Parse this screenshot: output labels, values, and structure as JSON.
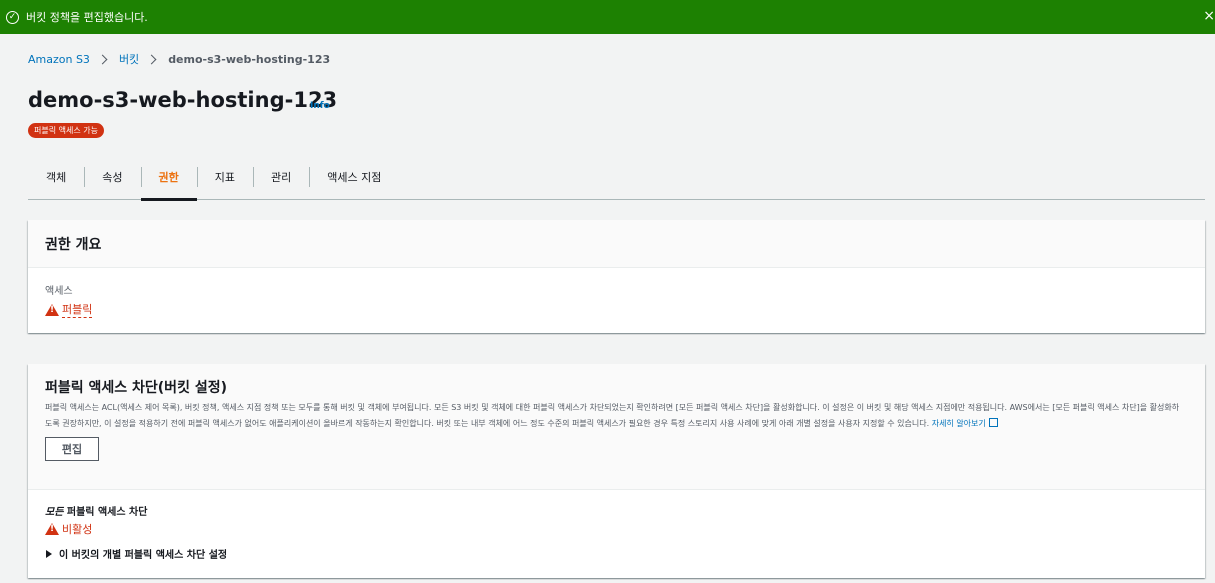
{
  "flash": {
    "message": "버킷 정책을 편집했습니다.",
    "close": "×"
  },
  "breadcrumb": {
    "items": [
      "Amazon S3",
      "버킷"
    ],
    "current": "demo-s3-web-hosting-123"
  },
  "header": {
    "title": "demo-s3-web-hosting-123",
    "info": "Info",
    "badge": "퍼블릭 액세스 가능"
  },
  "tabs": [
    {
      "label": "객체"
    },
    {
      "label": "속성"
    },
    {
      "label": "권한",
      "active": true
    },
    {
      "label": "지표"
    },
    {
      "label": "관리"
    },
    {
      "label": "액세스 지점"
    }
  ],
  "permissions_overview": {
    "title": "권한 개요",
    "access_label": "액세스",
    "access_value": "퍼블릭"
  },
  "block_public_access": {
    "title": "퍼블릭 액세스 차단(버킷 설정)",
    "description": "퍼블릭 액세스는 ACL(액세스 제어 목록), 버킷 정책, 액세스 지점 정책 또는 모두를 통해 버킷 및 객체에 부여됩니다. 모든 S3 버킷 및 객체에 대한 퍼블릭 액세스가 차단되었는지 확인하려면 [모든 퍼블릭 액세스 차단]을 활성화합니다. 이 설정은 이 버킷 및 해당 액세스 지점에만 적용됩니다. AWS에서는 [모든 퍼블릭 액세스 차단]을 활성화하도록 권장하지만, 이 설정을 적용하기 전에 퍼블릭 액세스가 없어도 애플리케이션이 올바르게 작동하는지 확인합니다. 버킷 또는 내부 객체에 어느 정도 수준의 퍼블릭 액세스가 필요한 경우 특정 스토리지 사용 사례에 맞게 아래 개별 설정을 사용자 지정할 수 있습니다.",
    "learn_more": "자세히 알아보기",
    "edit_button": "편집",
    "setting_title_em": "모든",
    "setting_title_rest": " 퍼블릭 액세스 차단",
    "setting_value": "비활성",
    "expander": "이 버킷의 개별 퍼블릭 액세스 차단 설정"
  },
  "colors": {
    "success": "#1d8102",
    "error": "#d13212",
    "link": "#0073bb",
    "active_tab": "#ec7211"
  }
}
